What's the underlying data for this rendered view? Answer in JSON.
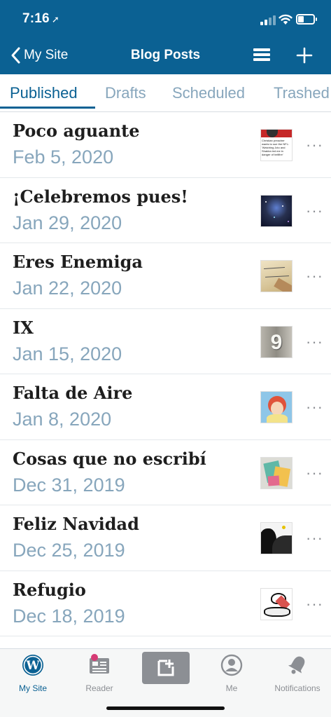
{
  "status_bar": {
    "time": "7:16"
  },
  "navbar": {
    "back_label": "My Site",
    "title": "Blog Posts"
  },
  "tabs": [
    {
      "label": "Published",
      "active": true
    },
    {
      "label": "Drafts",
      "active": false
    },
    {
      "label": "Scheduled",
      "active": false
    },
    {
      "label": "Trashed",
      "active": false
    }
  ],
  "posts": [
    {
      "title": "Poco aguante",
      "date": "Feb 5, 2020",
      "more": "···"
    },
    {
      "title": "¡Celebremos pues!",
      "date": "Jan 29, 2020",
      "more": "···"
    },
    {
      "title": "Eres Enemiga",
      "date": "Jan 22, 2020",
      "more": "···"
    },
    {
      "title": "IX",
      "date": "Jan 15, 2020",
      "more": "···"
    },
    {
      "title": "Falta de Aire",
      "date": "Jan 8, 2020",
      "more": "···"
    },
    {
      "title": "Cosas que no escribí",
      "date": "Dec 31, 2019",
      "more": "···"
    },
    {
      "title": "Feliz Navidad",
      "date": "Dec 25, 2019",
      "more": "···"
    },
    {
      "title": "Refugio",
      "date": "Dec 18, 2019",
      "more": "···"
    }
  ],
  "thumbnails": {
    "first_thumb_text": "Christian preacher wants to sue the NFL: 'Watching Jcto and Shakira led me in danger of hellfire'",
    "nine_thumb_text": "9"
  },
  "tab_bar": {
    "my_site": "My Site",
    "reader": "Reader",
    "me": "Me",
    "notifications": "Notifications"
  },
  "colors": {
    "brand": "#0b6193",
    "muted": "#87a6bc",
    "badge": "#d63b75"
  }
}
